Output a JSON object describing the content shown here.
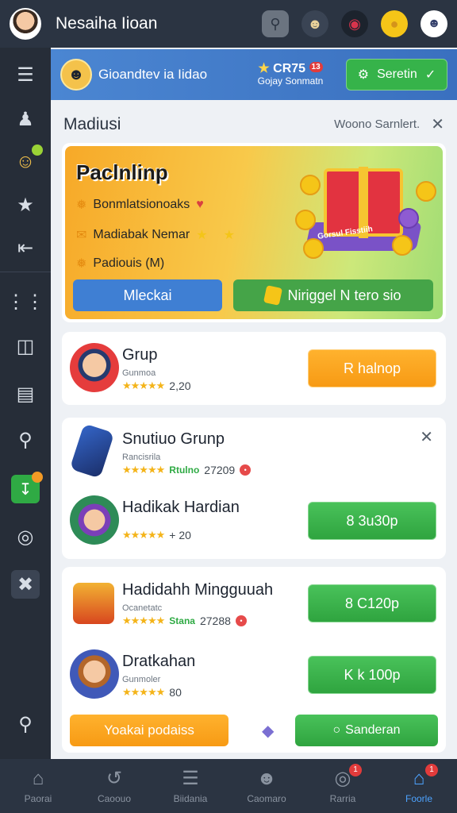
{
  "topbar": {
    "title": "Nesaiha Iioan",
    "icons": [
      "user-avatar-icon",
      "search-icon",
      "people-icon",
      "record-icon",
      "coin-icon",
      "profile-icon"
    ]
  },
  "sidebar": {
    "icons": [
      "menu-icon",
      "person-icon",
      "emoji-icon",
      "star-icon",
      "exit-icon",
      "apps-icon",
      "document-icon",
      "folder-icon",
      "search-icon",
      "download-icon",
      "disc-icon",
      "tools-icon",
      "search-bottom-icon"
    ]
  },
  "header_strip": {
    "name": "Gioandtev ia Iidao",
    "badge_text": "CR75",
    "badge_count": "13",
    "sub_text": "Gojay Sonmatn",
    "button_label": "Seretin"
  },
  "section": {
    "title": "Madiusi",
    "link": "Woono Sarnlert."
  },
  "promo": {
    "title": "Paclnlinp",
    "rows": [
      "Bonmlatsionoaks",
      "Madiabak Nemar",
      "Padiouis (M)"
    ],
    "banner_text": "Gorsul Fisstiih",
    "button1": "Mleckai",
    "button2": "Niriggel N tero sio"
  },
  "list1": [
    {
      "name": "Grup",
      "sub": "Gunmoa",
      "meta": "2,20",
      "button": "R halnop",
      "button_color": "#f79a14"
    }
  ],
  "list2": [
    {
      "name": "Snutiuo Grunp",
      "sub": "Rancisrila",
      "tag": "Rtulno",
      "meta": "27209",
      "button": ""
    },
    {
      "name": "Hadikak Hardian",
      "sub": "",
      "meta": "+ 20",
      "button": "8 3u30p",
      "button_color": "#2fa43f"
    }
  ],
  "list3": [
    {
      "name": "Hadidahh Mingguuah",
      "sub": "Ocanetatc",
      "tag": "Stana",
      "meta": "27288",
      "button": "8 C120p",
      "button_color": "#2fa43f"
    },
    {
      "name": "Dratkahan",
      "sub": "Gunmoler",
      "meta": "80",
      "button": "K k 100p",
      "button_color": "#2fa43f"
    }
  ],
  "bottom_actions": {
    "left": "Yoakai podaiss",
    "right": "Sanderan"
  },
  "bottom_nav": [
    {
      "label": "Paorai",
      "icon": "home-icon"
    },
    {
      "label": "Caoouo",
      "icon": "swirl-icon"
    },
    {
      "label": "Biidania",
      "icon": "chat-icon"
    },
    {
      "label": "Caomaro",
      "icon": "group-icon"
    },
    {
      "label": "Rarria",
      "icon": "target-icon",
      "badge": "1"
    },
    {
      "label": "Foorle",
      "icon": "home-active-icon",
      "badge": "1"
    }
  ],
  "stars": "★★★★★",
  "accent": "#36b34a"
}
